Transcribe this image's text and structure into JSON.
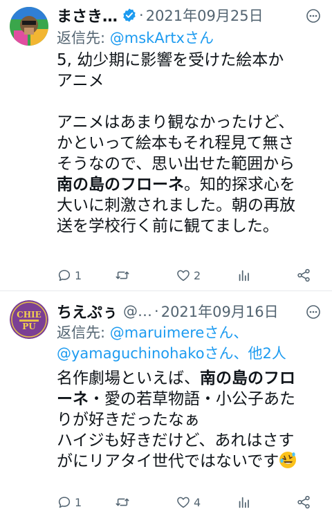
{
  "tweets": [
    {
      "display_name": "まさき…",
      "handle": "",
      "date": "2021年09月25日",
      "reply_prefix": "返信先: ",
      "reply_to": "@mskArtxさん",
      "reply_to_extra": "",
      "body_lines": [
        {
          "text": "5, 幼少期に影響を受けた絵本か",
          "bold": ""
        },
        {
          "text": "アニメ",
          "bold": ""
        },
        {
          "text": "",
          "bold": ""
        },
        {
          "text": "アニメはあまり観なかったけど、",
          "bold": ""
        },
        {
          "text": "かといって絵本もそれ程見て無さ",
          "bold": ""
        },
        {
          "text": "そうなので、思い出せた範囲から",
          "bold": ""
        },
        {
          "text": "。知的探求心を",
          "bold": "南の島のフローネ"
        },
        {
          "text": "大いに刺激されました。朝の再放",
          "bold": ""
        },
        {
          "text": "送を学校行く前に観てました。",
          "bold": ""
        }
      ],
      "replies": "1",
      "retweets": "",
      "likes": "2",
      "verified": true
    },
    {
      "display_name": "ちえぷぅ",
      "handle": "@…",
      "date": "2021年09月16日",
      "reply_prefix": "返信先: ",
      "reply_to": "@maruimereさん、",
      "reply_to_extra": "@yamaguchinohakoさん、他2人",
      "avatar_text": "CHIE PU",
      "body_lines": [
        {
          "pre": "名作劇場といえば、",
          "bold": "南の島のフロ"
        },
        {
          "pre": "",
          "bold": "ーネ",
          "post": "・愛の若草物語・小公子あた"
        },
        {
          "pre": "りが好きだったなぁ",
          "bold": ""
        },
        {
          "pre": "ハイジも好きだけど、あれはさす",
          "bold": ""
        },
        {
          "pre": "がにリアタイ世代ではないです",
          "bold": "",
          "emoji": "rolling-on-floor-laughing"
        }
      ],
      "replies": "1",
      "retweets": "",
      "likes": "4",
      "verified": false
    }
  ],
  "colors": {
    "text": "#0f1419",
    "secondary": "#536471",
    "link": "#1d9bf0",
    "verified": "#1d9bf0",
    "divider": "#e6e9ec"
  }
}
